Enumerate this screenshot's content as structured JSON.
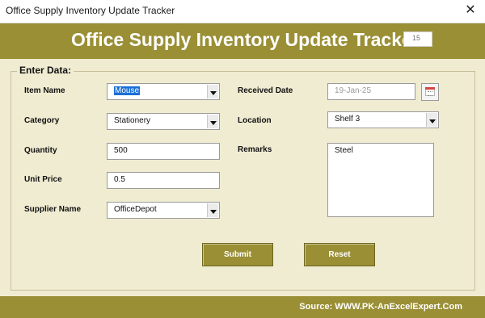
{
  "window": {
    "title": "Office Supply Inventory Update Tracker"
  },
  "header": {
    "title": "Office Supply Inventory Update Tracker",
    "counter": "15"
  },
  "form": {
    "legend": "Enter Data:",
    "item_name": {
      "label": "Item Name",
      "value": "Mouse"
    },
    "category": {
      "label": "Category",
      "value": "Stationery"
    },
    "quantity": {
      "label": "Quantity",
      "value": "500"
    },
    "unit_price": {
      "label": "Unit Price",
      "value": "0.5"
    },
    "supplier_name": {
      "label": "Supplier Name",
      "value": "OfficeDepot"
    },
    "received_date": {
      "label": "Received Date",
      "value": "19-Jan-25"
    },
    "location": {
      "label": "Location",
      "value": "Shelf 3"
    },
    "remarks": {
      "label": "Remarks",
      "value": "Steel"
    }
  },
  "buttons": {
    "submit": "Submit",
    "reset": "Reset"
  },
  "footer": {
    "source": "Source: WWW.PK-AnExcelExpert.Com"
  },
  "colors": {
    "accent": "#9a8f35",
    "background": "#f0ecd2",
    "selection": "#1b6fd6"
  },
  "icons": {
    "close": "close-icon",
    "calendar": "calendar-icon",
    "dropdown": "chevron-down-icon"
  }
}
